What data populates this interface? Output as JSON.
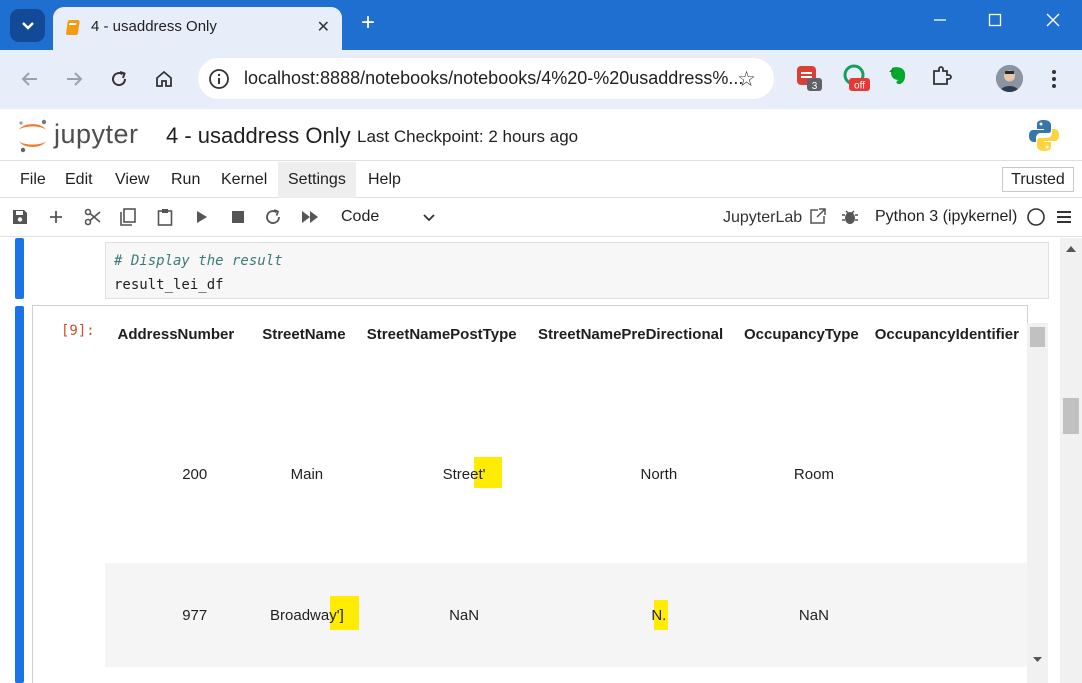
{
  "browser": {
    "tab_title": "4 - usaddress Only",
    "url": "localhost:8888/notebooks/notebooks/4%20-%20usaddress%...",
    "extensions": [
      {
        "name": "todoist-ext",
        "badge": "3"
      },
      {
        "name": "grammar-ext",
        "badge": "off"
      },
      {
        "name": "evernote-ext",
        "badge": ""
      }
    ]
  },
  "jupyter": {
    "logo_text": "jupyter",
    "notebook_title": "4 - usaddress Only",
    "checkpoint": "Last Checkpoint: 2 hours ago",
    "menu": [
      "File",
      "Edit",
      "View",
      "Run",
      "Kernel",
      "Settings",
      "Help"
    ],
    "active_menu": "Settings",
    "trusted_label": "Trusted",
    "cell_type": "Code",
    "jupyterlab_link": "JupyterLab",
    "kernel": "Python 3 (ipykernel)"
  },
  "cell": {
    "comment": "# Display the result",
    "code": "result_lei_df",
    "prompt": "[9]:"
  },
  "output_table": {
    "columns": [
      "AddressNumber",
      "StreetName",
      "StreetNamePostType",
      "StreetNamePreDirectional",
      "OccupancyType",
      "OccupancyIdentifier"
    ],
    "rows": [
      [
        "200",
        "Main",
        "Street'",
        "North",
        "Room",
        ""
      ],
      [
        "977",
        "Broadway']",
        "NaN",
        "N.",
        "NaN",
        ""
      ]
    ]
  },
  "colors": {
    "chrome_blue": "#1f6fd0",
    "cell_selected_bar": "#1a73e8",
    "highlight": "#ffec00",
    "prompt": "#c9502e"
  }
}
